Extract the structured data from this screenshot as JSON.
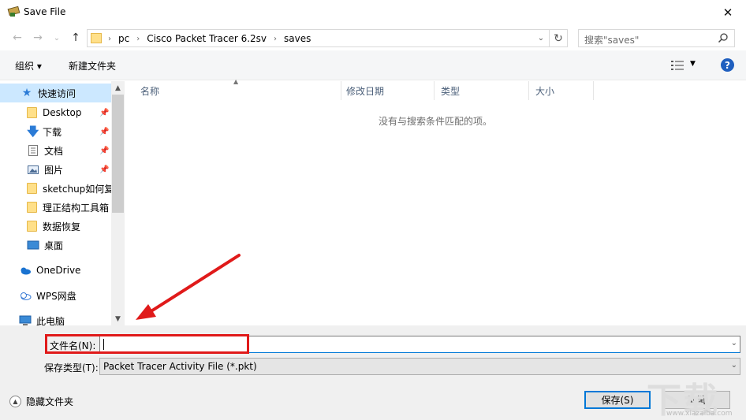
{
  "window": {
    "title": "Save File"
  },
  "nav": {
    "back": "←",
    "forward": "→",
    "recent": "⌄",
    "up": "↑"
  },
  "address": {
    "crumbs": [
      "pc",
      "Cisco Packet Tracer 6.2sv",
      "saves"
    ]
  },
  "search": {
    "placeholder": "搜索\"saves\""
  },
  "toolbar": {
    "organize": "组织 ▾",
    "new_folder": "新建文件夹"
  },
  "sidebar": {
    "quick_access": "快速访问",
    "items": [
      {
        "label": "Desktop",
        "icon": "folder-icon",
        "pinned": true
      },
      {
        "label": "下载",
        "icon": "download-icon",
        "pinned": true
      },
      {
        "label": "文档",
        "icon": "document-icon",
        "pinned": true
      },
      {
        "label": "图片",
        "icon": "picture-icon",
        "pinned": true
      },
      {
        "label": "sketchup如何复",
        "icon": "folder-icon",
        "pinned": false
      },
      {
        "label": "理正结构工具箱",
        "icon": "folder-icon",
        "pinned": false
      },
      {
        "label": "数据恢复",
        "icon": "folder-icon",
        "pinned": false
      },
      {
        "label": "桌面",
        "icon": "desktop-icon",
        "pinned": false
      }
    ],
    "onedrive": "OneDrive",
    "wps": "WPS网盘",
    "this_pc": "此电脑"
  },
  "columns": [
    "名称",
    "修改日期",
    "类型",
    "大小"
  ],
  "empty_message": "没有与搜索条件匹配的项。",
  "form": {
    "filename_label": "文件名(N):",
    "filename_value": "",
    "filetype_label": "保存类型(T):",
    "filetype_value": "Packet Tracer Activity File (*.pkt)"
  },
  "footer": {
    "hide_folders": "隐藏文件夹",
    "save": "保存(S)",
    "cancel": "取消"
  },
  "watermark": {
    "text": "下载吧",
    "url": "www.xiazaiba.com"
  },
  "colors": {
    "selection": "#cce8ff",
    "annotation": "#e01a1a",
    "accent": "#0078d7",
    "help": "#1f5fbf"
  }
}
